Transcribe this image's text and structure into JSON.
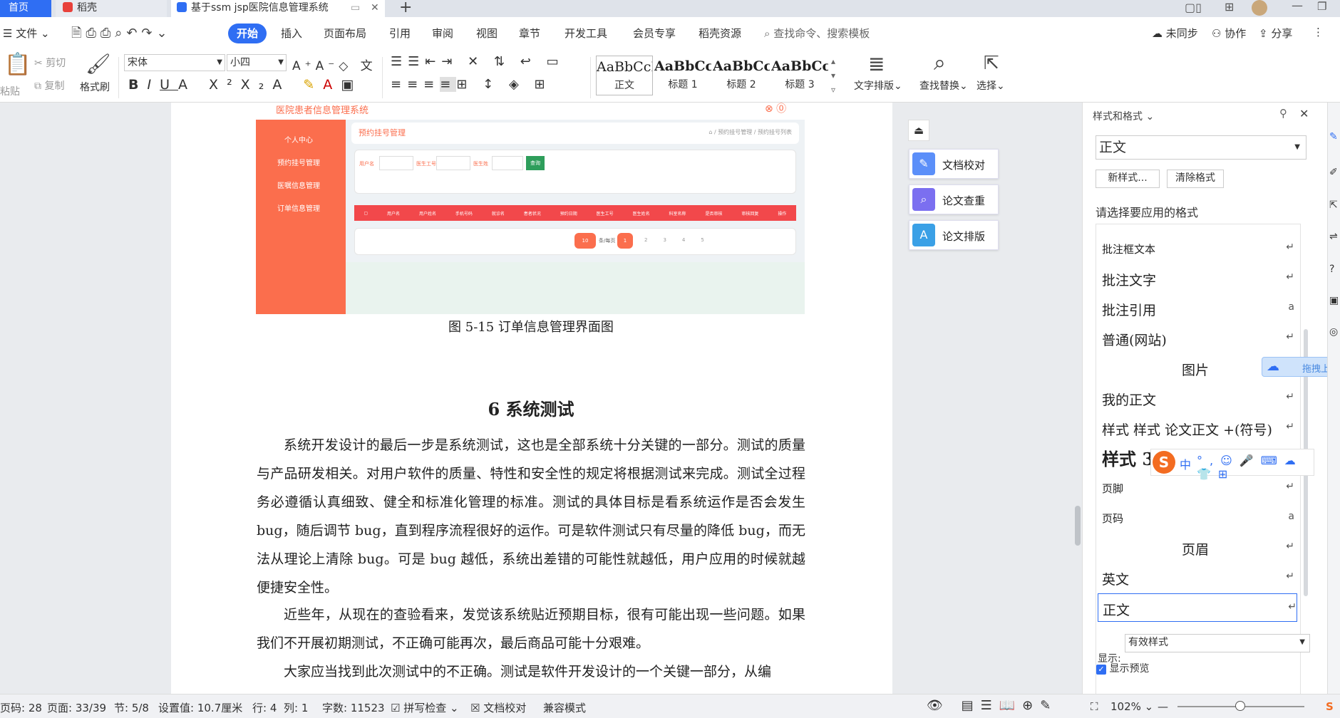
{
  "tabs": [
    {
      "label": "首页"
    },
    {
      "label": "稻壳"
    },
    {
      "label": "基于ssm jsp医院信息管理系统"
    }
  ],
  "menu": {
    "file": "文件",
    "items": [
      "开始",
      "插入",
      "页面布局",
      "引用",
      "审阅",
      "视图",
      "章节",
      "开发工具",
      "会员专享",
      "稻壳资源"
    ],
    "search": "查找命令、搜索模板",
    "sync": "未同步",
    "collab": "协作",
    "share": "分享"
  },
  "ribbon": {
    "paste": "粘贴",
    "cut": "剪切",
    "copy": "复制",
    "format_painter": "格式刷",
    "font": "宋体",
    "size": "小四",
    "styles": [
      {
        "sample": "AaBbCcI",
        "name": "正文"
      },
      {
        "sample": "AaBbCcI",
        "name": "标题 1"
      },
      {
        "sample": "AaBbCcI",
        "name": "标题 2"
      },
      {
        "sample": "AaBbCc",
        "name": "标题 3"
      }
    ],
    "layout": "文字排版",
    "find": "查找替换",
    "select": "选择"
  },
  "screenshot": {
    "title": "医院患者信息管理系统",
    "side": [
      "个人中心",
      "预约挂号管理",
      "医嘱信息管理",
      "订单信息管理"
    ],
    "card_title": "预约挂号管理",
    "breadcrumb": "⌂ / 预约挂号管理 / 预约挂号列表",
    "f1": "用户名",
    "f2": "医生工号",
    "f3": "医生姓",
    "btn": "查询",
    "cols": [
      "用户名",
      "用户姓名",
      "手机号码",
      "就诊名",
      "患者状况",
      "预约日期",
      "医生工号",
      "医生姓名",
      "科室名称",
      "是否审核",
      "审核回复",
      "操作"
    ],
    "pager": "条/每页",
    "pages": [
      "1",
      "2",
      "3",
      "4",
      "5"
    ],
    "count": "10"
  },
  "doc": {
    "caption": "图 5-15 订单信息管理界面图",
    "heading": "6 系统测试",
    "p1": "系统开发设计的最后一步是系统测试，这也是全部系统十分关键的一部分。测试的质量与产品研发相关。对用户软件的质量、特性和安全性的规定将根据测试来完成。测试全过程务必遵循认真细致、健全和标准化管理的标准。测试的具体目标是看系统运作是否会发生 bug，随后调节 bug，直到程序流程很好的运作。可是软件测试只有尽量的降低 bug，而无法从理论上清除 bug。可是 bug 越低，系统出差错的可能性就越低，用户应用的时候就越便捷安全性。",
    "p2": "近些年，从现在的查验看来，发觉该系统贴近预期目标，很有可能出现一些问题。如果我们不开展初期测试，不正确可能再次，最后商品可能十分艰难。",
    "p3": "大家应当找到此次测试中的不正确。测试是软件开发设计的一个关键一部分，从编"
  },
  "float": {
    "check": "文档校对",
    "dup": "论文查重",
    "fmt": "论文排版",
    "upload": "拖拽上传"
  },
  "panel": {
    "title": "样式和格式",
    "current": "正文",
    "new": "新样式...",
    "clear": "清除格式",
    "prompt": "请选择要应用的格式",
    "items": [
      {
        "name": "批注框文本",
        "mark": "↵"
      },
      {
        "name": "批注文字",
        "mark": "↵"
      },
      {
        "name": "批注引用",
        "mark": "a"
      },
      {
        "name": "普通(网站)",
        "mark": "↵"
      },
      {
        "name": "图片",
        "mark": ""
      },
      {
        "name": "我的正文",
        "mark": "↵"
      },
      {
        "name": "样式 样式 论文正文 +(符号)",
        "mark": "↵"
      },
      {
        "name": "样式 3",
        "mark": ""
      },
      {
        "name": "页脚",
        "mark": "↵"
      },
      {
        "name": "页码",
        "mark": "a"
      },
      {
        "name": "页眉",
        "mark": "↵"
      },
      {
        "name": "英文",
        "mark": "↵"
      },
      {
        "name": "正文",
        "mark": "↵"
      }
    ],
    "show_label": "显示:",
    "show_value": "有效样式",
    "preview": "显示预览"
  },
  "ime": {
    "lang": "中"
  },
  "status": {
    "pages": "页码: 28",
    "page": "页面: 33/39",
    "section": "节: 5/8",
    "setting": "设置值: 10.7厘米",
    "row": "行: 4",
    "col": "列: 1",
    "words": "字数: 11523",
    "spell": "拼写检查",
    "proof": "文档校对",
    "compat": "兼容模式",
    "zoom": "102%"
  },
  "colors": {
    "accent": "#2f6ef3",
    "screenshot_orange": "#fb6e4d",
    "table_red": "#f2484b"
  }
}
